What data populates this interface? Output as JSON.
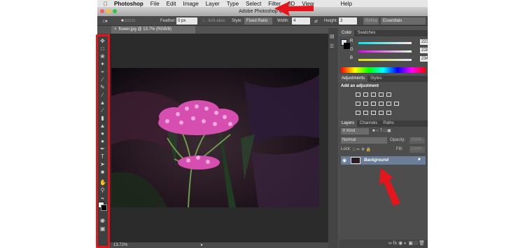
{
  "menu": {
    "app_name": "Photoshop",
    "items": [
      "File",
      "Edit",
      "Image",
      "Layer",
      "Type",
      "Select",
      "Filter",
      "3D",
      "View",
      "Help"
    ]
  },
  "window": {
    "title": "Adobe Photoshop CC"
  },
  "options_bar": {
    "feather_label": "Feather:",
    "feather_value": "0 px",
    "antialias_label": "Anti-alias",
    "style_label": "Style:",
    "style_value": "Fixed Ratio",
    "width_label": "Width:",
    "width_value": "4",
    "height_label": "Height:",
    "height_value": "3",
    "refine_label": "Refine",
    "workspace_value": "Essentials"
  },
  "document": {
    "tab_title": "flower.jpg @ 13.7% (RGB/8)",
    "zoom": "13.72%"
  },
  "color_panel": {
    "tabs": [
      "Color",
      "Swatches"
    ],
    "r_label": "R",
    "r_value": "223",
    "g_label": "G",
    "g_value": "228",
    "b_label": "B",
    "b_value": "234"
  },
  "adjustments_panel": {
    "tabs": [
      "Adjustments",
      "Styles"
    ],
    "heading": "Add an adjustment"
  },
  "layers_panel": {
    "tabs": [
      "Layers",
      "Channels",
      "Paths"
    ],
    "kind_label": "Kind",
    "blend_mode": "Normal",
    "opacity_label": "Opacity:",
    "opacity_value": "100%",
    "lock_label": "Lock:",
    "fill_label": "Fill:",
    "fill_value": "100%",
    "layer_name": "Background"
  },
  "colors": {
    "annotation_red": "#e8141c",
    "layer_selected": "#6a7d99"
  }
}
